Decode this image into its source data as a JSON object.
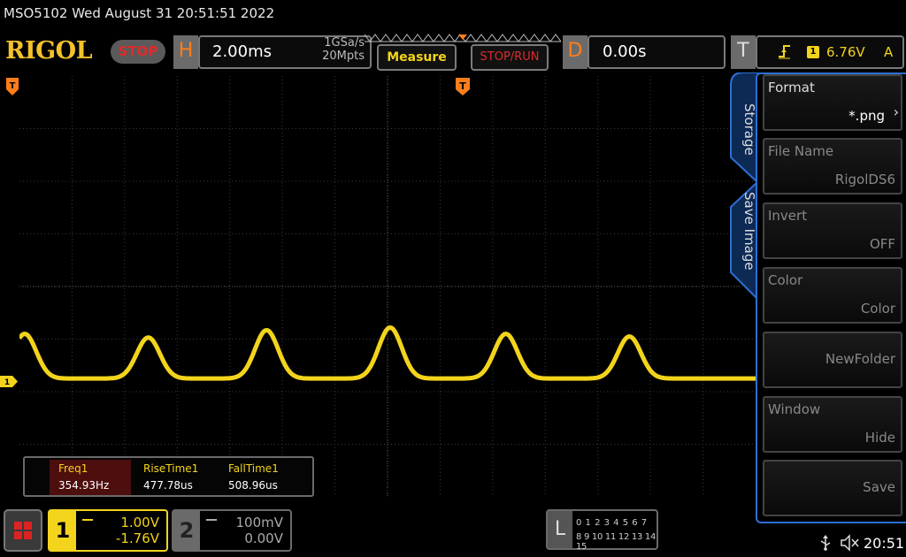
{
  "title_line": "MSO5102  Wed August 31 20:51:51 2022",
  "brand": {
    "logo": "RIGOL",
    "run_state": "STOP"
  },
  "horizontal": {
    "letter": "H",
    "timebase": "2.00ms",
    "sample_rate": "1GSa/s",
    "memory_depth": "20Mpts"
  },
  "buttons": {
    "measure": "Measure",
    "stop_run": "STOP/RUN"
  },
  "delay": {
    "letter": "D",
    "value": "0.00s"
  },
  "trigger": {
    "letter": "T",
    "source": "1",
    "level": "6.76V",
    "mode": "A",
    "edge_icon": "rising-edge-icon"
  },
  "measurements": [
    {
      "name": "Freq1",
      "value": "354.93Hz"
    },
    {
      "name": "RiseTime1",
      "value": "477.78us"
    },
    {
      "name": "FallTime1",
      "value": "508.96us"
    }
  ],
  "side_menu": {
    "tabs": [
      "Storage",
      "Save Image"
    ],
    "items": [
      {
        "label": "Format",
        "value": "*.png"
      },
      {
        "label": "File Name",
        "value": "RigolDS6"
      },
      {
        "label": "Invert",
        "value": "OFF"
      },
      {
        "label": "Color",
        "value": "Color"
      },
      {
        "label": "",
        "value": "NewFolder"
      },
      {
        "label": "Window",
        "value": "Hide"
      },
      {
        "label": "",
        "value": "Save"
      }
    ]
  },
  "channels": [
    {
      "number": "1",
      "scale": "1.00V",
      "offset": "-1.76V",
      "color": "#f3d41c",
      "coupling": "DC"
    },
    {
      "number": "2",
      "scale": "100mV",
      "offset": "0.00V",
      "color": "#8a8a8a",
      "coupling": "DC"
    }
  ],
  "logic_analyzer": {
    "letter": "L",
    "row1": "0 1 2 3  4 5 6 7",
    "row2": "8 9 10 11 12 13 14 15"
  },
  "markers": {
    "ch1": "1",
    "trigger_level": "T",
    "trigger_position": "T"
  },
  "status": {
    "time": "20:51",
    "usb_icon": "usb-icon",
    "speaker_icon": "speaker-muted-icon"
  },
  "waveform": {
    "channel": "1",
    "color": "#f3d41c",
    "baseline_divisions_below_center": 1.75,
    "peaks": [
      {
        "time_div": -6.9,
        "height_div": 0.85
      },
      {
        "time_div": -4.55,
        "height_div": 0.78
      },
      {
        "time_div": -2.3,
        "height_div": 0.92
      },
      {
        "time_div": 0.05,
        "height_div": 0.97
      },
      {
        "time_div": 2.25,
        "height_div": 0.85
      },
      {
        "time_div": 4.6,
        "height_div": 0.8
      }
    ]
  }
}
